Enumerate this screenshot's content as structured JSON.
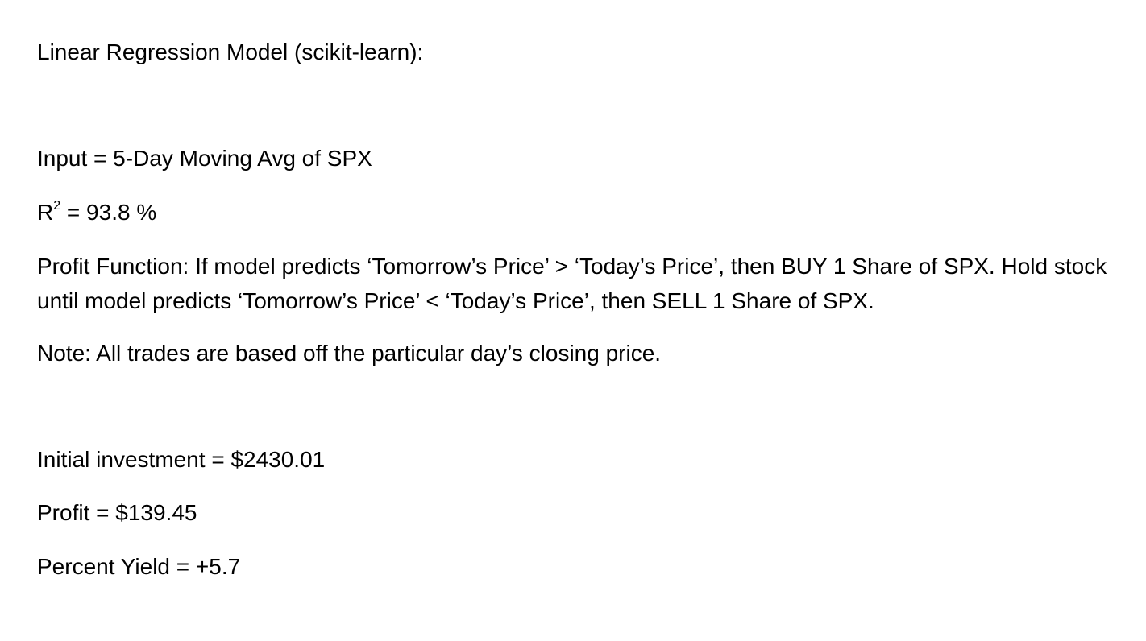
{
  "document": {
    "heading": "Linear Regression Model (scikit-learn):",
    "input_line": "Input = 5-Day Moving Avg of SPX",
    "r_squared": {
      "symbol": "R",
      "superscript": "2",
      "value_text": " = 93.8 %"
    },
    "profit_function": "Profit Function:  If model predicts ‘Tomorrow’s Price’ > ‘Today’s Price’, then BUY 1 Share of SPX. Hold stock until model predicts ‘Tomorrow’s Price’ < ‘Today’s Price’, then SELL 1 Share of SPX.",
    "note": "Note: All trades are based off the particular day’s closing price.",
    "initial_investment": "Initial investment = $2430.01",
    "profit": "Profit = $139.45",
    "percent_yield": "Percent Yield = +5.7"
  }
}
